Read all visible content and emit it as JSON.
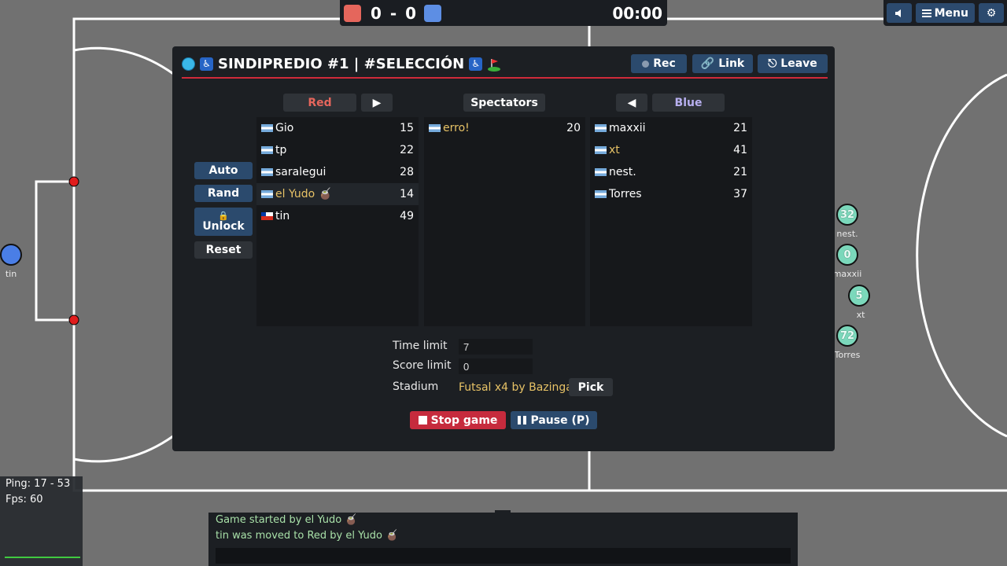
{
  "scoreboard": {
    "score": "0 - 0",
    "timer": "00:00"
  },
  "top_buttons": {
    "menu": "Menu"
  },
  "room": {
    "title": "SINDIPREDIO #1 | #SELECCIÓN",
    "rec_label": "Rec",
    "link_label": "Link",
    "leave_label": "Leave"
  },
  "columns": {
    "red": "Red",
    "spectators": "Spectators",
    "blue": "Blue"
  },
  "side_buttons": {
    "auto": "Auto",
    "rand": "Rand",
    "unlock": "Unlock",
    "reset": "Reset"
  },
  "red_team": [
    {
      "name": "Gio",
      "value": "15",
      "flag": "ar"
    },
    {
      "name": "tp",
      "value": "22",
      "flag": "ar"
    },
    {
      "name": "saralegui",
      "value": "28",
      "flag": "ar"
    },
    {
      "name": "el Yudo 🧉",
      "value": "14",
      "flag": "ar"
    },
    {
      "name": "tin",
      "value": "49",
      "flag": "cl"
    }
  ],
  "spectators": [
    {
      "name": "erro!",
      "value": "20",
      "flag": "ar"
    }
  ],
  "blue_team": [
    {
      "name": "maxxii",
      "value": "21",
      "flag": "ar"
    },
    {
      "name": "xt",
      "value": "41",
      "flag": "ar"
    },
    {
      "name": "nest.",
      "value": "21",
      "flag": "ar"
    },
    {
      "name": "Torres",
      "value": "37",
      "flag": "ar"
    }
  ],
  "settings": {
    "time_limit_label": "Time limit",
    "time_limit_value": "7",
    "score_limit_label": "Score limit",
    "score_limit_value": "0",
    "stadium_label": "Stadium",
    "stadium_value": "Futsal x4 by Bazinga...",
    "pick_label": "Pick"
  },
  "controls": {
    "stop": "Stop game",
    "pause": "Pause (P)"
  },
  "field_players": [
    {
      "number": "",
      "name": "tin",
      "team": "blue"
    },
    {
      "number": "32",
      "name": "nest.",
      "team": "green"
    },
    {
      "number": "0",
      "name": "maxxii",
      "team": "green"
    },
    {
      "number": "5",
      "name": "xt",
      "team": "green"
    },
    {
      "number": "72",
      "name": "Torres",
      "team": "green"
    }
  ],
  "stats": {
    "ping": "Ping: 17 - 53",
    "fps": "Fps: 60"
  },
  "chat": [
    "Game started by el Yudo 🧉",
    "tin was moved to Red by el Yudo 🧉"
  ],
  "colors": {
    "red_team": "#e5665c",
    "blue_team": "#5d8ee4",
    "accent_line": "#d02a3a",
    "gold_name": "#e7c266"
  }
}
